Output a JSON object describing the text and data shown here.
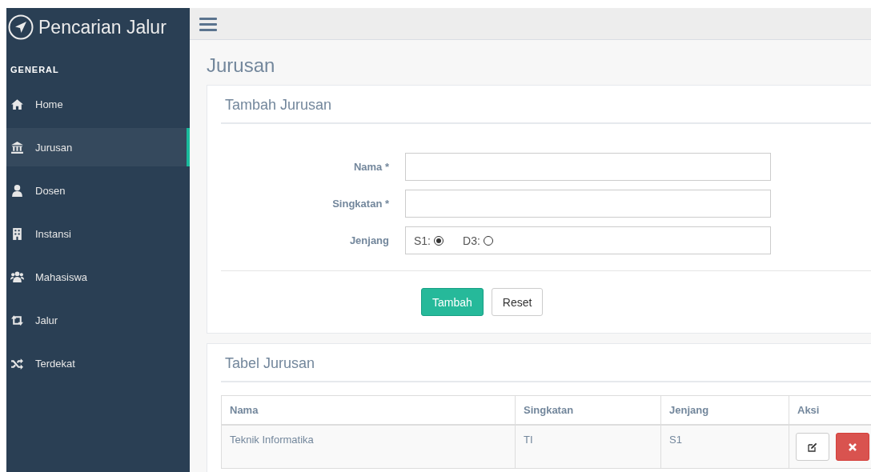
{
  "sidebar": {
    "title": "Pencarian Jalur",
    "section": "GENERAL",
    "items": [
      {
        "label": "Home",
        "kind": "home",
        "selected": false
      },
      {
        "label": "Jurusan",
        "kind": "bank",
        "selected": true
      },
      {
        "label": "Dosen",
        "kind": "user",
        "selected": false
      },
      {
        "label": "Instansi",
        "kind": "building",
        "selected": false
      },
      {
        "label": "Mahasiswa",
        "kind": "users",
        "selected": false
      },
      {
        "label": "Jalur",
        "kind": "retweet",
        "selected": false
      },
      {
        "label": "Terdekat",
        "kind": "random",
        "selected": false
      }
    ]
  },
  "page_title": "Jurusan",
  "form_panel": {
    "title": "Tambah Jurusan",
    "fields": [
      {
        "kind": "text",
        "label": "Nama *"
      },
      {
        "kind": "text",
        "label": "Singkatan *"
      },
      {
        "kind": "radio",
        "label": "Jenjang",
        "options": [
          {
            "label": "S1:",
            "selected": true
          },
          {
            "label": "D3:",
            "selected": false
          }
        ]
      }
    ],
    "buttons": [
      {
        "label": "Tambah",
        "kind": "primary"
      },
      {
        "label": "Reset",
        "kind": "default"
      }
    ]
  },
  "table_panel": {
    "title": "Tabel Jurusan",
    "columns": [
      "Nama",
      "Singkatan",
      "Jenjang",
      "Aksi"
    ],
    "rows": [
      {
        "cells": [
          "Teknik Informatika",
          "TI",
          "S1"
        ]
      }
    ]
  }
}
